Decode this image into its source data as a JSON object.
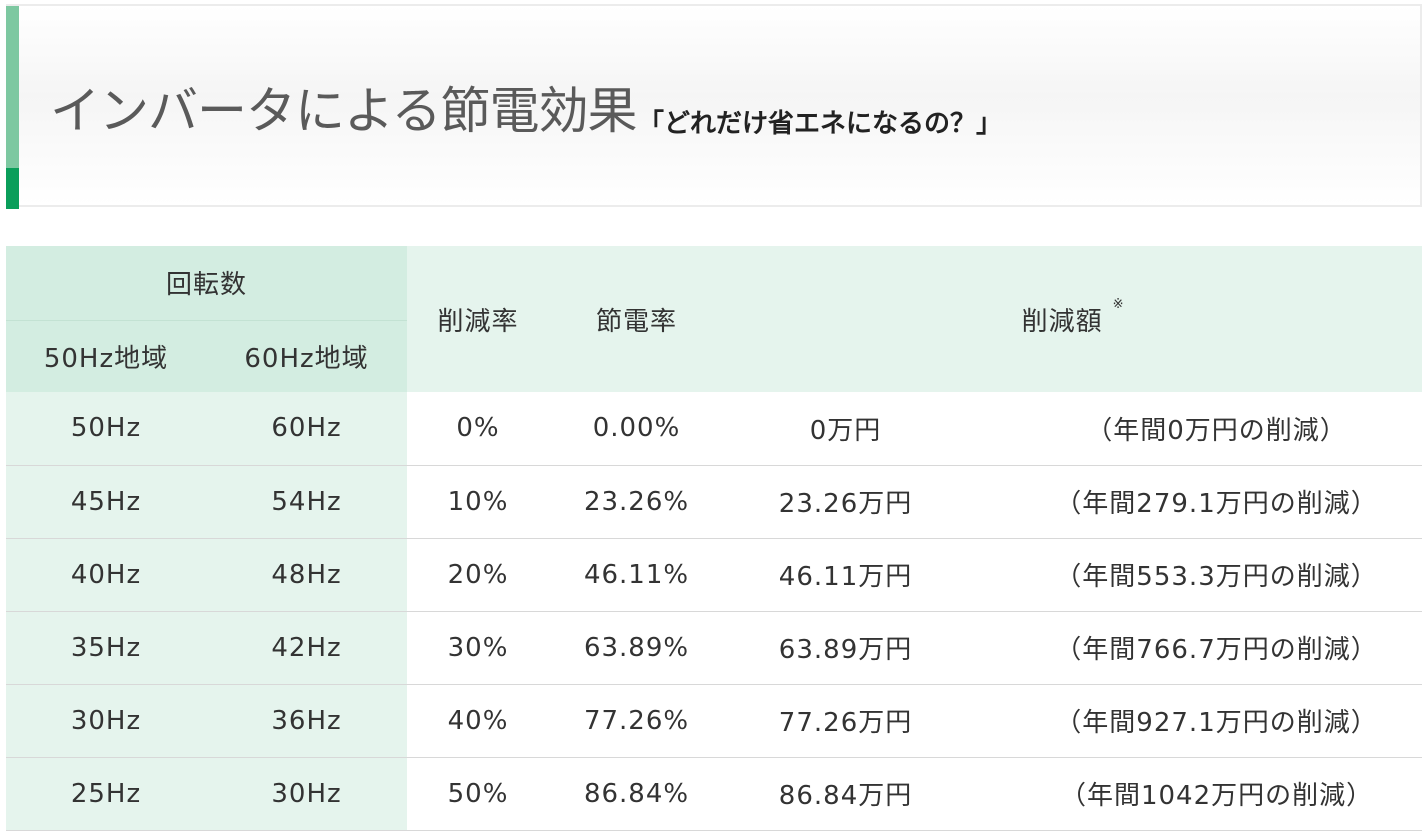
{
  "header": {
    "title": "インバータによる節電効果",
    "subtitle": "「どれだけ省エネになるの？」"
  },
  "table": {
    "headers": {
      "rpm_group": "回転数",
      "region50": "50Hz地域",
      "region60": "60Hz地域",
      "reduction_rate": "削減率",
      "saving_rate": "節電率",
      "reduction_amount": "削減額",
      "note_mark": "※"
    },
    "rows": [
      {
        "hz50": "50Hz",
        "hz60": "60Hz",
        "reduction": "0%",
        "saving": "0.00%",
        "amount": "0万円",
        "annual": "（年間0万円の削減）"
      },
      {
        "hz50": "45Hz",
        "hz60": "54Hz",
        "reduction": "10%",
        "saving": "23.26%",
        "amount": "23.26万円",
        "annual": "（年間279.1万円の削減）"
      },
      {
        "hz50": "40Hz",
        "hz60": "48Hz",
        "reduction": "20%",
        "saving": "46.11%",
        "amount": "46.11万円",
        "annual": "（年間553.3万円の削減）"
      },
      {
        "hz50": "35Hz",
        "hz60": "42Hz",
        "reduction": "30%",
        "saving": "63.89%",
        "amount": "63.89万円",
        "annual": "（年間766.7万円の削減）"
      },
      {
        "hz50": "30Hz",
        "hz60": "36Hz",
        "reduction": "40%",
        "saving": "77.26%",
        "amount": "77.26万円",
        "annual": "（年間927.1万円の削減）"
      },
      {
        "hz50": "25Hz",
        "hz60": "30Hz",
        "reduction": "50%",
        "saving": "86.84%",
        "amount": "86.84万円",
        "annual": "（年間1042万円の削減）"
      }
    ]
  },
  "colors": {
    "accent_green": "#0a9e5a",
    "light_green": "#7dc8a1",
    "header_bg": "#d3ede1",
    "cell_bg": "#e5f4ed"
  }
}
